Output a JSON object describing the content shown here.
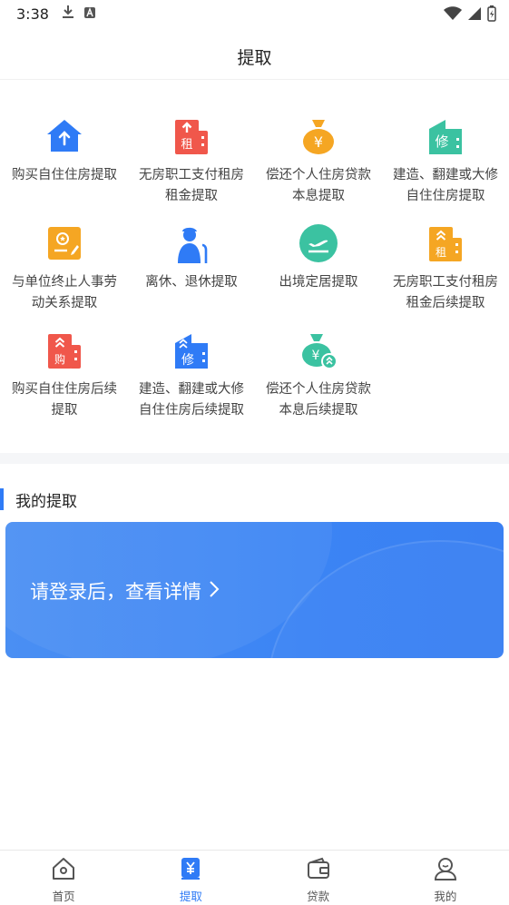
{
  "status_bar": {
    "time": "3:38"
  },
  "header": {
    "title": "提取"
  },
  "services": [
    {
      "label": "购买自住住房提取",
      "icon": "house-upload-icon",
      "color": "#2f7bf6"
    },
    {
      "label": "无房职工支付租房租金提取",
      "icon": "rent-building-icon",
      "color": "#f0574b"
    },
    {
      "label": "偿还个人住房贷款本息提取",
      "icon": "money-bag-icon",
      "color": "#f5a623"
    },
    {
      "label": "建造、翻建或大修自住住房提取",
      "icon": "repair-building-icon",
      "color": "#3bc2a1"
    },
    {
      "label": "与单位终止人事劳动关系提取",
      "icon": "certificate-icon",
      "color": "#f5a623"
    },
    {
      "label": "离休、退休提取",
      "icon": "elderly-person-icon",
      "color": "#2f7bf6"
    },
    {
      "label": "出境定居提取",
      "icon": "airplane-icon",
      "color": "#3bc2a1"
    },
    {
      "label": "无房职工支付租房租金后续提取",
      "icon": "rent-building-followup-icon",
      "color": "#f5a623"
    },
    {
      "label": "购买自住住房后续提取",
      "icon": "purchase-building-icon",
      "color": "#f0574b"
    },
    {
      "label": "建造、翻建或大修自住住房后续提取",
      "icon": "repair-building-followup-icon",
      "color": "#2f7bf6"
    },
    {
      "label": "偿还个人住房贷款本息后续提取",
      "icon": "money-bag-followup-icon",
      "color": "#3bc2a1"
    }
  ],
  "my_withdrawal": {
    "section_title": "我的提取",
    "login_prompt": "请登录后，查看详情"
  },
  "tabbar": {
    "items": [
      {
        "label": "首页",
        "icon": "home-icon",
        "active": false
      },
      {
        "label": "提取",
        "icon": "yuan-withdraw-icon",
        "active": true
      },
      {
        "label": "贷款",
        "icon": "wallet-icon",
        "active": false
      },
      {
        "label": "我的",
        "icon": "user-icon",
        "active": false
      }
    ]
  },
  "colors": {
    "accent": "#2f7bf6",
    "card_bg": "#3b84f4"
  }
}
